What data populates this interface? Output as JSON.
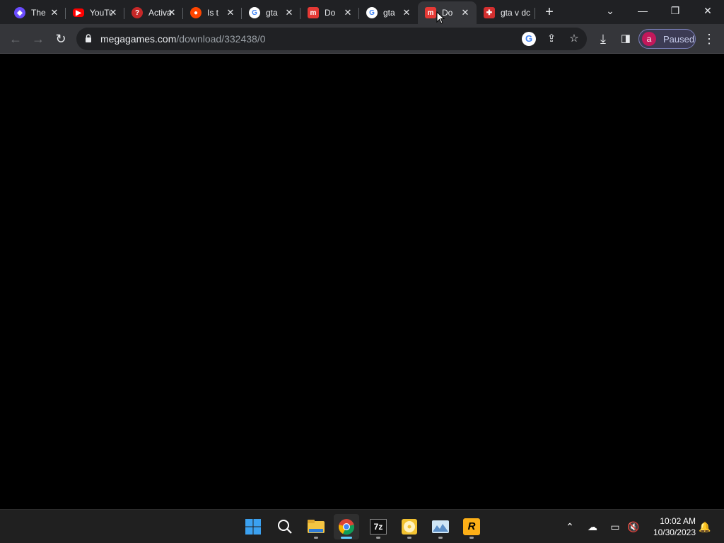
{
  "browser": {
    "tabs": [
      {
        "title": "The",
        "icon": "purple-app-icon",
        "color": "#6a4cff"
      },
      {
        "title": "YouTube",
        "icon": "youtube-icon",
        "color": "#ff0000"
      },
      {
        "title": "Activation",
        "icon": "help-circle-icon",
        "color": "#c62828"
      },
      {
        "title": "Is t",
        "icon": "reddit-icon",
        "color": "#ff4500"
      },
      {
        "title": "gta",
        "icon": "google-icon",
        "color": "#ffffff"
      },
      {
        "title": "Do",
        "icon": "megagames-icon",
        "color": "#e53935"
      },
      {
        "title": "gta",
        "icon": "google-icon",
        "color": "#ffffff"
      },
      {
        "title": "Do",
        "icon": "megagames-icon",
        "color": "#e53935",
        "active": true
      },
      {
        "title": "gta v dc",
        "icon": "gamepad-icon",
        "color": "#d32f2f"
      }
    ],
    "url_host": "megagames.com",
    "url_path": "/download/332438/0",
    "profile_initial": "a",
    "profile_status": "Paused"
  },
  "taskbar": {
    "apps": [
      "start-icon",
      "search-icon",
      "file-explorer-icon",
      "chrome-icon",
      "7zip-icon",
      "disc-app-icon",
      "photo-app-icon",
      "rockstar-icon"
    ],
    "seven_zip_label": "7z",
    "rockstar_label": "R",
    "time": "10:02 AM",
    "date": "10/30/2023"
  },
  "colors": {
    "tab_strip": "#202124",
    "toolbar": "#35363a",
    "taskbar": "#202020",
    "accent": "#60cdff"
  }
}
